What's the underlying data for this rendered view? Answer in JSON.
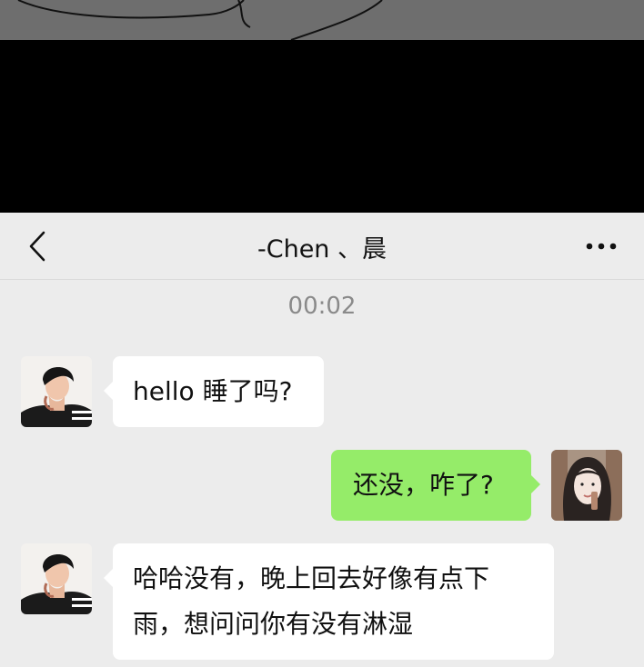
{
  "header": {
    "title": "-Chen 、晨",
    "back_icon": "chevron-left-icon",
    "more_icon": "more-dots-icon"
  },
  "chat": {
    "timestamp": "00:02",
    "messages": [
      {
        "side": "left",
        "sender_avatar": "contact-avatar",
        "text": "hello 睡了吗?"
      },
      {
        "side": "right",
        "sender_avatar": "self-avatar",
        "text": "还没，咋了?"
      },
      {
        "side": "left",
        "sender_avatar": "contact-avatar",
        "text_lines": [
          "哈哈没有，晚上回去好像有点下",
          "雨，想问问你有没有淋湿"
        ]
      }
    ]
  },
  "colors": {
    "background": "#ececec",
    "incoming_bubble": "#ffffff",
    "outgoing_bubble": "#95ec69",
    "top_band": "#000000"
  }
}
